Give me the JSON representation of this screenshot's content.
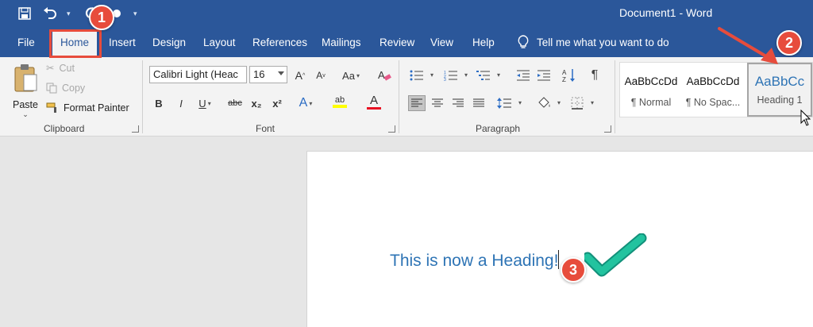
{
  "window": {
    "title": "Document1  -  Word"
  },
  "quick_access": {
    "items": [
      "save-icon",
      "undo-icon",
      "redo-icon",
      "customize-icon"
    ]
  },
  "tabs": [
    "File",
    "Home",
    "Insert",
    "Design",
    "Layout",
    "References",
    "Mailings",
    "Review",
    "View",
    "Help"
  ],
  "tell_me": {
    "placeholder": "Tell me what you want to do"
  },
  "clipboard": {
    "paste_label": "Paste",
    "cut_label": "Cut",
    "copy_label": "Copy",
    "format_painter_label": "Format Painter",
    "group_label": "Clipboard"
  },
  "font": {
    "name": "Calibri Light (Heac",
    "size": "16",
    "group_label": "Font",
    "grow_glyph": "A",
    "shrink_glyph": "A",
    "case_glyph": "Aa",
    "bold": "B",
    "italic": "I",
    "underline": "U",
    "strikethrough": "abc",
    "subscript": "x₂",
    "superscript": "x²",
    "effects_glyph": "A",
    "highlight_glyph": "ab",
    "color_glyph": "A",
    "highlight_color": "#ffff00",
    "font_color": "#e81123"
  },
  "paragraph": {
    "group_label": "Paragraph",
    "pilcrow": "¶"
  },
  "styles": {
    "items": [
      {
        "preview": "AaBbCcDd",
        "name": "¶ Normal"
      },
      {
        "preview": "AaBbCcDd",
        "name": "¶ No Spac..."
      },
      {
        "preview": "AaBbCc",
        "name": "Heading 1"
      }
    ]
  },
  "document": {
    "text": "This is now a Heading!"
  },
  "annotations": {
    "step1": "1",
    "step2": "2",
    "step3": "3"
  },
  "colors": {
    "word_blue": "#2b579a",
    "heading_blue": "#2e74b5",
    "callout_red": "#e74c3c",
    "check_teal": "#1abc9c"
  }
}
